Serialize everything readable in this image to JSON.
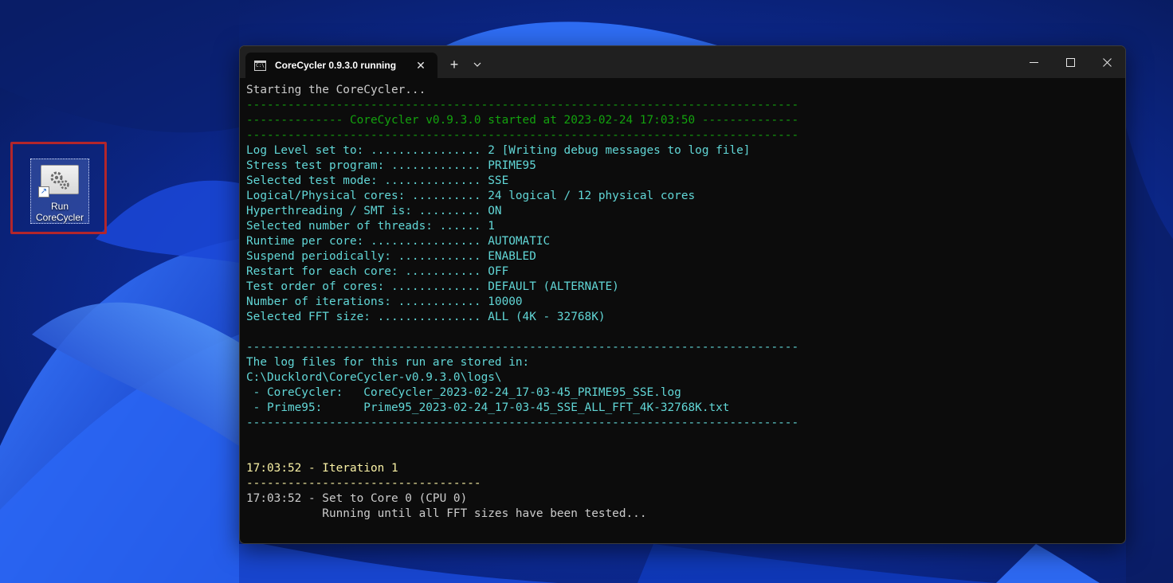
{
  "desktop": {
    "shortcut": {
      "label": "Run\nCoreCycler",
      "icon": "gears-shortcut-icon"
    }
  },
  "window": {
    "tab_title": "CoreCycler 0.9.3.0 running",
    "tab_icon_text": "C:\\",
    "tab_close": "✕",
    "new_tab": "+",
    "tab_dropdown": "⌄",
    "minimize": "—",
    "maximize": "☐",
    "close": "✕"
  },
  "colors": {
    "default_text": "#cccccc",
    "info_text": "#61d6d6",
    "header_text": "#13a10e",
    "iteration_text": "#f9f1a5"
  },
  "console": {
    "lines": [
      {
        "text": "Starting the CoreCycler...",
        "color": "white"
      },
      {
        "text": "--------------------------------------------------------------------------------",
        "color": "green"
      },
      {
        "text": "-------------- CoreCycler v0.9.3.0 started at 2023-02-24 17:03:50 --------------",
        "color": "green"
      },
      {
        "text": "--------------------------------------------------------------------------------",
        "color": "green"
      },
      {
        "text": "Log Level set to: ................ 2 [Writing debug messages to log file]",
        "color": "cyan"
      },
      {
        "text": "Stress test program: ............. PRIME95",
        "color": "cyan"
      },
      {
        "text": "Selected test mode: .............. SSE",
        "color": "cyan"
      },
      {
        "text": "Logical/Physical cores: .......... 24 logical / 12 physical cores",
        "color": "cyan"
      },
      {
        "text": "Hyperthreading / SMT is: ......... ON",
        "color": "cyan"
      },
      {
        "text": "Selected number of threads: ...... 1",
        "color": "cyan"
      },
      {
        "text": "Runtime per core: ................ AUTOMATIC",
        "color": "cyan"
      },
      {
        "text": "Suspend periodically: ............ ENABLED",
        "color": "cyan"
      },
      {
        "text": "Restart for each core: ........... OFF",
        "color": "cyan"
      },
      {
        "text": "Test order of cores: ............. DEFAULT (ALTERNATE)",
        "color": "cyan"
      },
      {
        "text": "Number of iterations: ............ 10000",
        "color": "cyan"
      },
      {
        "text": "Selected FFT size: ............... ALL (4K - 32768K)",
        "color": "cyan"
      },
      {
        "text": "",
        "color": "cyan"
      },
      {
        "text": "--------------------------------------------------------------------------------",
        "color": "cyan"
      },
      {
        "text": "The log files for this run are stored in:",
        "color": "cyan"
      },
      {
        "text": "C:\\Ducklord\\CoreCycler-v0.9.3.0\\logs\\",
        "color": "cyan"
      },
      {
        "text": " - CoreCycler:   CoreCycler_2023-02-24_17-03-45_PRIME95_SSE.log",
        "color": "cyan"
      },
      {
        "text": " - Prime95:      Prime95_2023-02-24_17-03-45_SSE_ALL_FFT_4K-32768K.txt",
        "color": "cyan"
      },
      {
        "text": "--------------------------------------------------------------------------------",
        "color": "cyan"
      },
      {
        "text": "",
        "color": "white"
      },
      {
        "text": "",
        "color": "white"
      },
      {
        "text": "17:03:52 - Iteration 1",
        "color": "yellow"
      },
      {
        "text": "----------------------------------",
        "color": "yellow"
      },
      {
        "text": "17:03:52 - Set to Core 0 (CPU 0)",
        "color": "white"
      },
      {
        "text": "           Running until all FFT sizes have been tested...",
        "color": "white"
      }
    ]
  }
}
